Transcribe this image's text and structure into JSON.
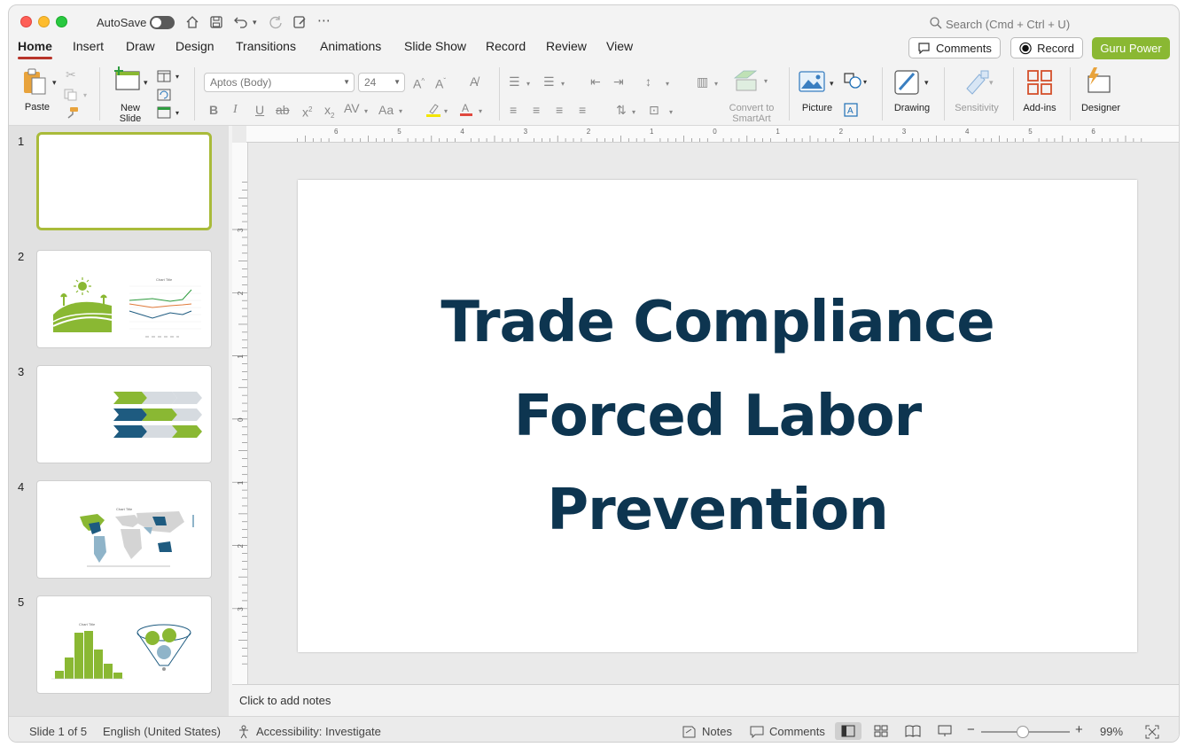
{
  "titlebar": {
    "autosave_label": "AutoSave",
    "search_placeholder": "Search (Cmd + Ctrl + U)"
  },
  "menu_tabs": [
    {
      "label": "Home",
      "active": true
    },
    {
      "label": "Insert"
    },
    {
      "label": "Draw"
    },
    {
      "label": "Design"
    },
    {
      "label": "Transitions"
    },
    {
      "label": "Animations"
    },
    {
      "label": "Slide Show"
    },
    {
      "label": "Record"
    },
    {
      "label": "Review"
    },
    {
      "label": "View"
    }
  ],
  "header_buttons": {
    "comments": "Comments",
    "record": "Record",
    "guru": "Guru Power"
  },
  "ribbon": {
    "paste": "Paste",
    "new_slide_line1": "New",
    "new_slide_line2": "Slide",
    "font_name": "Aptos (Body)",
    "font_size": "24",
    "convert_line1": "Convert to",
    "convert_line2": "SmartArt",
    "picture": "Picture",
    "drawing": "Drawing",
    "sensitivity": "Sensitivity",
    "addins": "Add-ins",
    "designer": "Designer"
  },
  "slides": [
    {
      "number": "1"
    },
    {
      "number": "2",
      "chart_title": "Chart Title"
    },
    {
      "number": "3"
    },
    {
      "number": "4",
      "chart_title": "Chart Title"
    },
    {
      "number": "5",
      "chart_title": "Chart Title"
    }
  ],
  "ruler": {
    "h_ticks": [
      "6",
      "5",
      "4",
      "3",
      "2",
      "1",
      "0",
      "1",
      "2",
      "3",
      "4",
      "5",
      "6"
    ],
    "v_ticks": [
      "3",
      "2",
      "1",
      "0",
      "1",
      "2",
      "3"
    ]
  },
  "slide": {
    "title_lines": [
      "Trade Compliance",
      "Forced Labor",
      "Prevention"
    ],
    "title_color": "#0d3550"
  },
  "notes_placeholder": "Click to add notes",
  "statusbar": {
    "slide_info": "Slide 1 of 5",
    "language": "English (United States)",
    "accessibility": "Accessibility: Investigate",
    "notes": "Notes",
    "comments": "Comments",
    "zoom": "99%"
  },
  "colors": {
    "accent_green": "#8ab833",
    "dark_blue": "#1e5b80",
    "light_blue": "#8fb4c9",
    "gray": "#d6dbe0",
    "active_tab_underline": "#b8342a"
  }
}
